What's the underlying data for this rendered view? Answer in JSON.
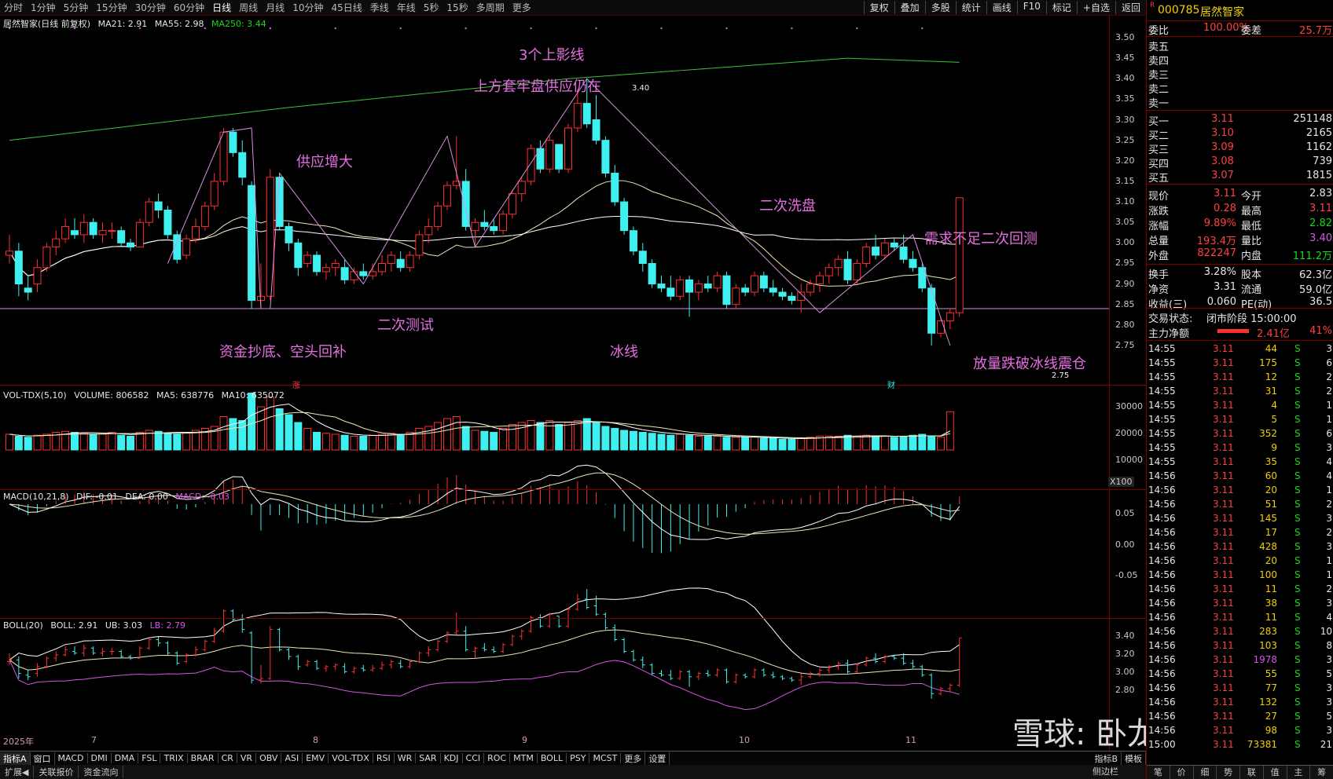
{
  "toolbar": {
    "periods": [
      "分时",
      "1分钟",
      "5分钟",
      "15分钟",
      "30分钟",
      "60分钟",
      "日线",
      "周线",
      "月线",
      "10分钟",
      "45日线",
      "季线",
      "年线",
      "5秒",
      "15秒",
      "多周期",
      "更多"
    ],
    "active_period": "日线",
    "right_tools": [
      "复权",
      "叠加",
      "多股",
      "统计",
      "画线",
      "F10",
      "标记",
      "+自选",
      "返回"
    ]
  },
  "main_chart": {
    "title": "居然智家(日线 前复权)",
    "ma21": "MA21: 2.91",
    "ma55": "MA55: 2.98",
    "ma250": "MA250: 3.44",
    "y_ticks": [
      "3.50",
      "3.45",
      "3.40",
      "3.35",
      "3.30",
      "3.25",
      "3.20",
      "3.15",
      "3.10",
      "3.05",
      "3.00",
      "2.95",
      "2.90",
      "2.85",
      "2.80",
      "2.75"
    ],
    "high_label": "3.40",
    "low_label": "2.75",
    "marker_zhang": "涨",
    "marker_cai": "财",
    "colors": {
      "up": "#ff3030",
      "down": "#3ff0f0",
      "ma250": "#3cc03c",
      "ma21": "#e0e0b0",
      "ma55": "#ffffff",
      "annotation": "#e46fe0"
    }
  },
  "annotations": {
    "a1": "3个上影线",
    "a2": "上方套牢盘供应仍在",
    "a3": "供应增大",
    "a4": "二次洗盘",
    "a5": "需求不足二次回测",
    "a6": "二次测试",
    "a7": "资金抄底、空头回补",
    "a8": "冰线",
    "a9": "放量跌破冰线震仓"
  },
  "volume": {
    "legend_name": "VOL-TDX(5,10)",
    "volume": "VOLUME: 806582",
    "ma5": "MA5: 638776",
    "ma10": "MA10: 635072",
    "y_ticks": [
      "30000",
      "20000",
      "10000"
    ],
    "unit": "X100"
  },
  "macd": {
    "legend_name": "MACD(10,21,8)",
    "dif": "DIF: -0.01",
    "dea": "DEA: 0.00",
    "macd": "MACD: -0.03",
    "y_ticks": [
      "0.05",
      "0.00",
      "-0.05"
    ]
  },
  "boll": {
    "legend_name": "BOLL(20)",
    "boll": "BOLL: 2.91",
    "ub": "UB: 3.03",
    "lb": "LB: 2.79",
    "y_ticks": [
      "3.40",
      "3.20",
      "3.00",
      "2.80"
    ]
  },
  "x_axis": [
    "2025年",
    "7",
    "8",
    "9",
    "10",
    "11"
  ],
  "bottom_tabs": [
    "指标A",
    "窗口",
    "MACD",
    "DMI",
    "DMA",
    "FSL",
    "TRIX",
    "BRAR",
    "CR",
    "VR",
    "OBV",
    "ASI",
    "EMV",
    "VOL-TDX",
    "RSI",
    "WR",
    "SAR",
    "KDJ",
    "CCI",
    "ROC",
    "MTM",
    "BOLL",
    "PSY",
    "MCST",
    "更多",
    "设置",
    "指标B",
    "模板"
  ],
  "status_bar": [
    "扩展◀",
    "关联报价",
    "资金流向"
  ],
  "status_right": "侧边栏",
  "watermark": "雪球: 卧龙V",
  "quote": {
    "code": "000785",
    "name": "居然智家",
    "r_badge": "R",
    "weibi_l": "委比",
    "weibi_v": "100.00%",
    "weicha_l": "委差",
    "weicha_v": "25.7万",
    "sell": [
      {
        "label": "卖五",
        "price": "",
        "vol": ""
      },
      {
        "label": "卖四",
        "price": "",
        "vol": ""
      },
      {
        "label": "卖三",
        "price": "",
        "vol": ""
      },
      {
        "label": "卖二",
        "price": "",
        "vol": ""
      },
      {
        "label": "卖一",
        "price": "",
        "vol": ""
      }
    ],
    "buy": [
      {
        "label": "买一",
        "price": "3.11",
        "vol": "251148"
      },
      {
        "label": "买二",
        "price": "3.10",
        "vol": "2165"
      },
      {
        "label": "买三",
        "price": "3.09",
        "vol": "1162"
      },
      {
        "label": "买四",
        "price": "3.08",
        "vol": "739"
      },
      {
        "label": "买五",
        "price": "3.07",
        "vol": "1815"
      }
    ],
    "stats": [
      {
        "l1": "现价",
        "v1": "3.11",
        "l2": "今开",
        "v2": "2.83"
      },
      {
        "l1": "涨跌",
        "v1": "0.28",
        "l2": "最高",
        "v2": "3.11"
      },
      {
        "l1": "涨幅",
        "v1": "9.89%",
        "l2": "最低",
        "v2": "2.82"
      },
      {
        "l1": "总量",
        "v1": "193.4万",
        "l2": "量比",
        "v2": "3.40"
      },
      {
        "l1": "外盘",
        "v1": "822247",
        "l2": "内盘",
        "v2": "111.2万"
      }
    ],
    "stats2": [
      {
        "l1": "换手",
        "v1": "3.28%",
        "l2": "股本",
        "v2": "62.3亿"
      },
      {
        "l1": "净资",
        "v1": "3.31",
        "l2": "流通",
        "v2": "59.0亿"
      },
      {
        "l1": "收益(三)",
        "v1": "0.060",
        "l2": "PE(动)",
        "v2": "36.5"
      }
    ],
    "trade_state_l": "交易状态:",
    "trade_state_v": "闭市阶段 15:00:00",
    "main_net_l": "主力净额",
    "main_net_v": "2.41亿",
    "main_pct": "41%"
  },
  "ticks": [
    {
      "t": "14:55",
      "p": "3.11",
      "v": "44",
      "s": "S",
      "n": "3"
    },
    {
      "t": "14:55",
      "p": "3.11",
      "v": "175",
      "s": "S",
      "n": "6"
    },
    {
      "t": "14:55",
      "p": "3.11",
      "v": "12",
      "s": "S",
      "n": "2"
    },
    {
      "t": "14:55",
      "p": "3.11",
      "v": "31",
      "s": "S",
      "n": "2"
    },
    {
      "t": "14:55",
      "p": "3.11",
      "v": "4",
      "s": "S",
      "n": "1"
    },
    {
      "t": "14:55",
      "p": "3.11",
      "v": "5",
      "s": "S",
      "n": "1"
    },
    {
      "t": "14:55",
      "p": "3.11",
      "v": "352",
      "s": "S",
      "n": "6"
    },
    {
      "t": "14:55",
      "p": "3.11",
      "v": "9",
      "s": "S",
      "n": "3"
    },
    {
      "t": "14:55",
      "p": "3.11",
      "v": "35",
      "s": "S",
      "n": "4"
    },
    {
      "t": "14:56",
      "p": "3.11",
      "v": "60",
      "s": "S",
      "n": "4"
    },
    {
      "t": "14:56",
      "p": "3.11",
      "v": "20",
      "s": "S",
      "n": "1"
    },
    {
      "t": "14:56",
      "p": "3.11",
      "v": "51",
      "s": "S",
      "n": "2"
    },
    {
      "t": "14:56",
      "p": "3.11",
      "v": "145",
      "s": "S",
      "n": "3"
    },
    {
      "t": "14:56",
      "p": "3.11",
      "v": "17",
      "s": "S",
      "n": "2"
    },
    {
      "t": "14:56",
      "p": "3.11",
      "v": "428",
      "s": "S",
      "n": "3"
    },
    {
      "t": "14:56",
      "p": "3.11",
      "v": "20",
      "s": "S",
      "n": "1"
    },
    {
      "t": "14:56",
      "p": "3.11",
      "v": "100",
      "s": "S",
      "n": "1"
    },
    {
      "t": "14:56",
      "p": "3.11",
      "v": "11",
      "s": "S",
      "n": "2"
    },
    {
      "t": "14:56",
      "p": "3.11",
      "v": "38",
      "s": "S",
      "n": "3"
    },
    {
      "t": "14:56",
      "p": "3.11",
      "v": "11",
      "s": "S",
      "n": "4"
    },
    {
      "t": "14:56",
      "p": "3.11",
      "v": "283",
      "s": "S",
      "n": "10"
    },
    {
      "t": "14:56",
      "p": "3.11",
      "v": "103",
      "s": "S",
      "n": "8"
    },
    {
      "t": "14:56",
      "p": "3.11",
      "v": "1978",
      "s": "S",
      "n": "3"
    },
    {
      "t": "14:56",
      "p": "3.11",
      "v": "55",
      "s": "S",
      "n": "5"
    },
    {
      "t": "14:56",
      "p": "3.11",
      "v": "77",
      "s": "S",
      "n": "3"
    },
    {
      "t": "14:56",
      "p": "3.11",
      "v": "132",
      "s": "S",
      "n": "3"
    },
    {
      "t": "14:56",
      "p": "3.11",
      "v": "27",
      "s": "S",
      "n": "5"
    },
    {
      "t": "14:56",
      "p": "3.11",
      "v": "98",
      "s": "S",
      "n": "3"
    },
    {
      "t": "15:00",
      "p": "3.11",
      "v": "73381",
      "s": "S",
      "n": "21"
    }
  ],
  "right_bottom_tabs": [
    "笔",
    "价",
    "细",
    "势",
    "联",
    "值",
    "主",
    "筹"
  ],
  "chart_data": {
    "type": "candlestick",
    "candles": [
      [
        2.97,
        3.02,
        2.95,
        2.98
      ],
      [
        2.98,
        3.0,
        2.87,
        2.9
      ],
      [
        2.89,
        2.92,
        2.86,
        2.88
      ],
      [
        2.9,
        2.96,
        2.88,
        2.94
      ],
      [
        2.94,
        3.0,
        2.93,
        2.99
      ],
      [
        2.99,
        3.03,
        2.97,
        3.01
      ],
      [
        3.01,
        3.06,
        3.0,
        3.04
      ],
      [
        3.03,
        3.06,
        3.01,
        3.02
      ],
      [
        3.02,
        3.07,
        3.0,
        3.05
      ],
      [
        3.05,
        3.06,
        3.01,
        3.02
      ],
      [
        3.02,
        3.05,
        3.0,
        3.03
      ],
      [
        3.03,
        3.05,
        3.01,
        3.03
      ],
      [
        3.03,
        3.04,
        2.99,
        3.0
      ],
      [
        3.0,
        3.01,
        2.98,
        2.99
      ],
      [
        2.99,
        3.06,
        2.99,
        3.05
      ],
      [
        3.05,
        3.11,
        3.04,
        3.1
      ],
      [
        3.1,
        3.12,
        3.06,
        3.08
      ],
      [
        3.08,
        3.09,
        3.01,
        3.02
      ],
      [
        3.02,
        3.03,
        2.95,
        2.96
      ],
      [
        2.97,
        3.02,
        2.96,
        3.01
      ],
      [
        3.01,
        3.06,
        3.0,
        3.04
      ],
      [
        3.04,
        3.1,
        3.03,
        3.09
      ],
      [
        3.09,
        3.17,
        3.08,
        3.15
      ],
      [
        3.15,
        3.28,
        3.14,
        3.27
      ],
      [
        3.27,
        3.28,
        3.21,
        3.22
      ],
      [
        3.22,
        3.25,
        3.14,
        3.16
      ],
      [
        3.14,
        3.15,
        2.84,
        2.86
      ],
      [
        2.86,
        2.95,
        2.84,
        2.87
      ],
      [
        2.87,
        3.18,
        2.86,
        3.16
      ],
      [
        3.16,
        3.17,
        3.03,
        3.04
      ],
      [
        3.04,
        3.05,
        2.98,
        3.0
      ],
      [
        3.0,
        3.01,
        2.92,
        2.94
      ],
      [
        2.95,
        2.98,
        2.94,
        2.97
      ],
      [
        2.97,
        2.98,
        2.92,
        2.93
      ],
      [
        2.93,
        2.95,
        2.91,
        2.94
      ],
      [
        2.94,
        2.96,
        2.92,
        2.95
      ],
      [
        2.94,
        2.96,
        2.9,
        2.91
      ],
      [
        2.91,
        2.94,
        2.9,
        2.93
      ],
      [
        2.93,
        2.95,
        2.91,
        2.92
      ],
      [
        2.92,
        2.95,
        2.91,
        2.93
      ],
      [
        2.93,
        2.97,
        2.92,
        2.95
      ],
      [
        2.95,
        2.98,
        2.93,
        2.97
      ],
      [
        2.96,
        2.98,
        2.93,
        2.94
      ],
      [
        2.94,
        2.98,
        2.93,
        2.97
      ],
      [
        2.97,
        3.03,
        2.96,
        3.02
      ],
      [
        3.02,
        3.06,
        3.0,
        3.04
      ],
      [
        3.04,
        3.1,
        3.03,
        3.09
      ],
      [
        3.09,
        3.15,
        3.08,
        3.14
      ],
      [
        3.14,
        3.26,
        3.13,
        3.15
      ],
      [
        3.15,
        3.18,
        3.03,
        3.04
      ],
      [
        3.03,
        3.06,
        2.99,
        3.05
      ],
      [
        3.05,
        3.08,
        3.03,
        3.04
      ],
      [
        3.04,
        3.06,
        3.02,
        3.03
      ],
      [
        3.03,
        3.08,
        3.02,
        3.07
      ],
      [
        3.07,
        3.13,
        3.06,
        3.12
      ],
      [
        3.12,
        3.16,
        3.1,
        3.15
      ],
      [
        3.15,
        3.24,
        3.14,
        3.23
      ],
      [
        3.23,
        3.25,
        3.17,
        3.18
      ],
      [
        3.18,
        3.26,
        3.17,
        3.25
      ],
      [
        3.24,
        3.24,
        3.17,
        3.18
      ],
      [
        3.18,
        3.29,
        3.17,
        3.28
      ],
      [
        3.28,
        3.37,
        3.27,
        3.34
      ],
      [
        3.34,
        3.4,
        3.28,
        3.29
      ],
      [
        3.3,
        3.36,
        3.24,
        3.25
      ],
      [
        3.25,
        3.26,
        3.16,
        3.17
      ],
      [
        3.17,
        3.19,
        3.09,
        3.1
      ],
      [
        3.1,
        3.11,
        3.02,
        3.03
      ],
      [
        3.03,
        3.04,
        2.97,
        2.98
      ],
      [
        2.98,
        3.0,
        2.93,
        2.95
      ],
      [
        2.95,
        2.96,
        2.89,
        2.9
      ],
      [
        2.9,
        2.92,
        2.88,
        2.89
      ],
      [
        2.89,
        2.92,
        2.86,
        2.87
      ],
      [
        2.87,
        2.92,
        2.86,
        2.91
      ],
      [
        2.91,
        2.92,
        2.82,
        2.88
      ],
      [
        2.88,
        2.91,
        2.86,
        2.9
      ],
      [
        2.9,
        2.92,
        2.88,
        2.89
      ],
      [
        2.89,
        2.93,
        2.88,
        2.92
      ],
      [
        2.92,
        2.93,
        2.84,
        2.85
      ],
      [
        2.85,
        2.9,
        2.84,
        2.89
      ],
      [
        2.89,
        2.9,
        2.87,
        2.88
      ],
      [
        2.88,
        2.93,
        2.87,
        2.92
      ],
      [
        2.92,
        2.93,
        2.88,
        2.89
      ],
      [
        2.89,
        2.91,
        2.87,
        2.88
      ],
      [
        2.88,
        2.89,
        2.86,
        2.87
      ],
      [
        2.87,
        2.88,
        2.85,
        2.86
      ],
      [
        2.86,
        2.9,
        2.83,
        2.88
      ],
      [
        2.88,
        2.91,
        2.87,
        2.9
      ],
      [
        2.9,
        2.93,
        2.88,
        2.92
      ],
      [
        2.92,
        2.95,
        2.9,
        2.94
      ],
      [
        2.94,
        2.97,
        2.92,
        2.96
      ],
      [
        2.96,
        2.98,
        2.9,
        2.91
      ],
      [
        2.91,
        2.96,
        2.9,
        2.95
      ],
      [
        2.95,
        3.0,
        2.94,
        2.99
      ],
      [
        2.99,
        3.02,
        2.96,
        2.97
      ],
      [
        2.97,
        3.01,
        2.96,
        3.0
      ],
      [
        3.0,
        3.01,
        2.98,
        2.99
      ],
      [
        2.99,
        3.02,
        2.95,
        2.96
      ],
      [
        2.96,
        2.98,
        2.93,
        2.94
      ],
      [
        2.94,
        2.95,
        2.88,
        2.89
      ],
      [
        2.89,
        2.9,
        2.75,
        2.78
      ],
      [
        2.78,
        2.82,
        2.77,
        2.81
      ],
      [
        2.81,
        2.84,
        2.79,
        2.83
      ],
      [
        2.83,
        3.11,
        2.82,
        3.11
      ]
    ],
    "volume": [
      8000,
      7000,
      6500,
      7500,
      8000,
      9000,
      9500,
      9000,
      8500,
      8000,
      8000,
      9000,
      7500,
      7000,
      9000,
      10000,
      9500,
      8500,
      8000,
      9000,
      10000,
      11000,
      12000,
      17000,
      16000,
      15000,
      29000,
      22000,
      27000,
      21000,
      18000,
      14000,
      11000,
      9000,
      8500,
      8000,
      7500,
      7000,
      7000,
      7500,
      8000,
      8500,
      8000,
      9000,
      11000,
      12000,
      14000,
      16000,
      17000,
      12000,
      10000,
      9500,
      9000,
      11000,
      13000,
      14000,
      15000,
      14000,
      15000,
      13000,
      14000,
      15000,
      16000,
      14000,
      12000,
      11000,
      10000,
      9500,
      9000,
      8500,
      8000,
      7500,
      8000,
      7500,
      7000,
      7000,
      7000,
      6500,
      6500,
      6500,
      6500,
      6000,
      6000,
      5500,
      5500,
      6000,
      6500,
      7000,
      7000,
      7000,
      7500,
      7000,
      7500,
      7000,
      7000,
      6500,
      7000,
      7500,
      8000,
      7000,
      6500,
      19500
    ],
    "ma250": {
      "x_days": [
        0,
        30,
        60,
        90,
        102
      ],
      "values": [
        3.25,
        3.33,
        3.4,
        3.45,
        3.44
      ]
    }
  }
}
